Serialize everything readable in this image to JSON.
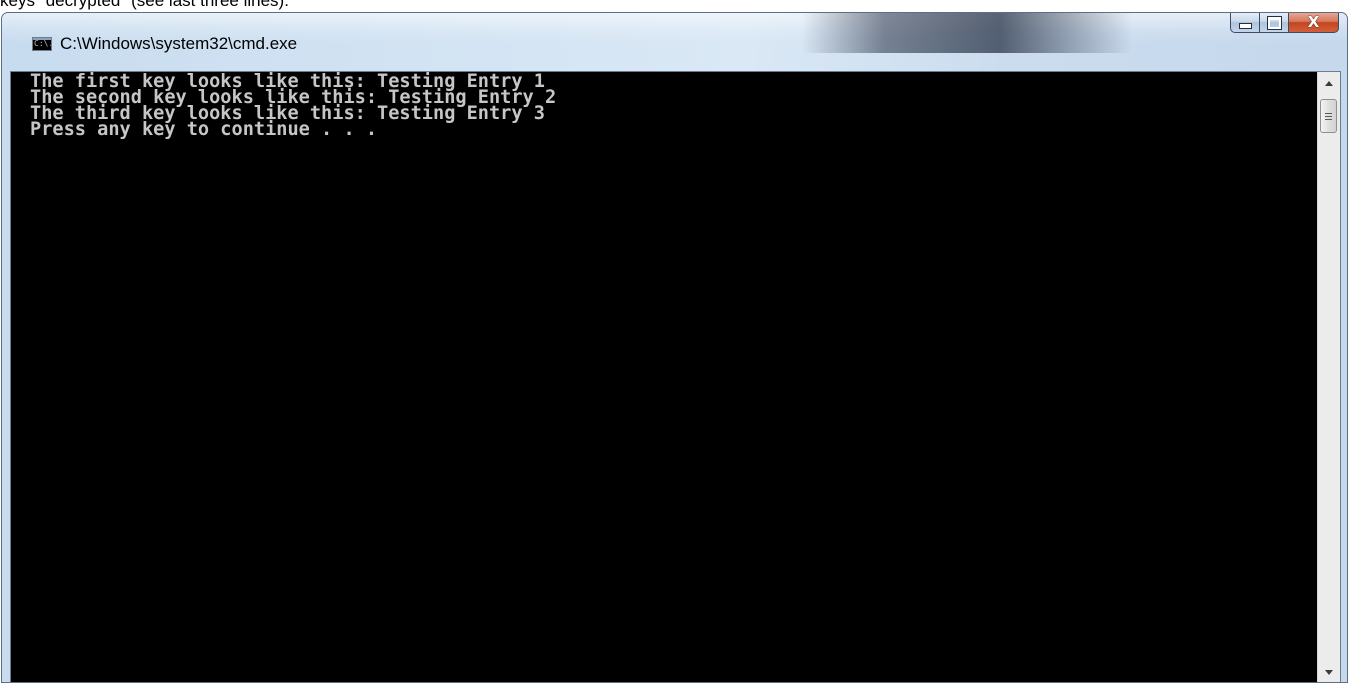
{
  "document": {
    "caption": "keys \"decrypted\" (see last three lines)."
  },
  "window": {
    "title": "C:\\Windows\\system32\\cmd.exe",
    "icon_label": "C:\\.",
    "icon": "cmd-icon",
    "buttons": {
      "minimize": "minimize-icon",
      "maximize": "maximize-icon",
      "close": "close-icon",
      "close_glyph": "X"
    },
    "accent_colors": {
      "titlebar": "#d2e3f3",
      "close_button": "#c2461f",
      "console_background": "#000000",
      "console_text": "#c6c6c6"
    }
  },
  "console": {
    "lines": [
      "The first key looks like this: Testing Entry 1",
      "The second key looks like this: Testing Entry 2",
      "The third key looks like this: Testing Entry 3",
      "Press any key to continue . . ."
    ]
  },
  "scrollbar": {
    "up_icon": "scroll-up-arrow-icon",
    "down_icon": "scroll-down-arrow-icon",
    "thumb_icon": "scroll-thumb-grip-icon"
  }
}
